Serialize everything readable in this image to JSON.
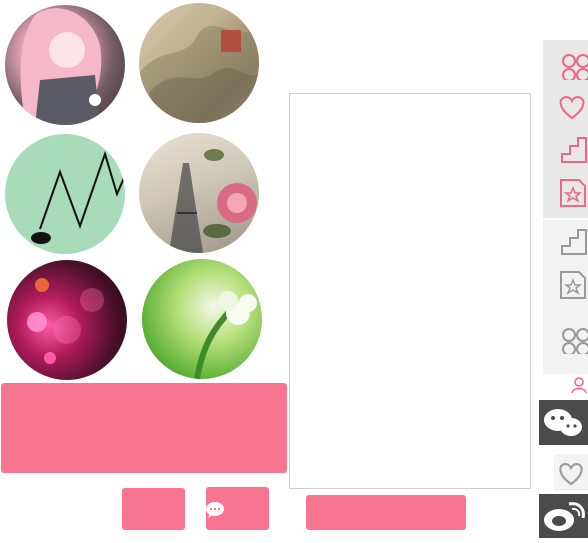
{
  "avatars": [
    {
      "name": "anime-girl"
    },
    {
      "name": "ink-landscape"
    },
    {
      "name": "green-zigzag"
    },
    {
      "name": "eiffel-tower-roses"
    },
    {
      "name": "pink-bokeh-flower"
    },
    {
      "name": "green-blossom"
    }
  ],
  "colors": {
    "accent": "#f8758f",
    "icon_pink": "#f06783",
    "icon_gray": "#9a9a9a",
    "dark": "#4b4b4b"
  },
  "sidebar": {
    "icons": [
      "grid-icon",
      "heart-icon",
      "stairs-icon",
      "star-doc-icon",
      "stairs-icon",
      "star-doc-icon",
      "grid-icon",
      "user-icon",
      "wechat-icon",
      "heart-icon",
      "weibo-icon"
    ]
  }
}
